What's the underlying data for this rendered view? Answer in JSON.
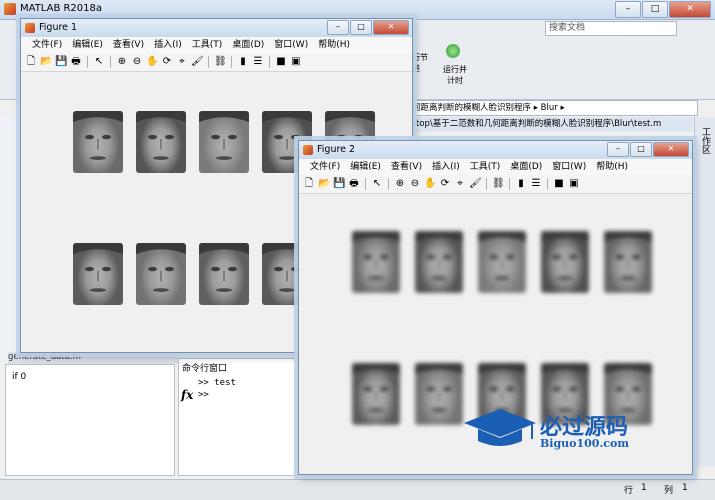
{
  "app": {
    "title": "MATLAB R2018a",
    "search_placeholder": "搜索文档",
    "toolstrip": {
      "section_label": "行节 进",
      "run_advance_label": "运行并 计时"
    },
    "path": "何距离判断的模糊人脸识别程序 ▸ Blur ▸",
    "file_path": "ktop\\基于二范数和几何距离判断的模糊人脸识别程序\\Blur\\test.m",
    "right_panel_label": "工作区",
    "editor_file": "generate_data.m",
    "workspace_line": "if 0",
    "command_window_title": "命令行窗口",
    "command_lines": [
      ">> test",
      ">>"
    ],
    "fx_label": "fx",
    "status": {
      "row_label": "行",
      "row_value": "1",
      "col_label": "列",
      "col_value": "1"
    }
  },
  "figure1": {
    "title": "Figure 1",
    "menu": [
      "文件(F)",
      "编辑(E)",
      "查看(V)",
      "插入(I)",
      "工具(T)",
      "桌面(D)",
      "窗口(W)",
      "帮助(H)"
    ],
    "faces_count": 10
  },
  "figure2": {
    "title": "Figure 2",
    "menu": [
      "文件(F)",
      "编辑(E)",
      "查看(V)",
      "插入(I)",
      "工具(T)",
      "桌面(D)",
      "窗口(W)",
      "帮助(H)"
    ],
    "faces_count": 10
  },
  "watermark": {
    "text": "必过源码",
    "url": "Biguo100.com"
  },
  "colors": {
    "title_bar": "#cadbee",
    "accent": "#1b5fb5"
  }
}
